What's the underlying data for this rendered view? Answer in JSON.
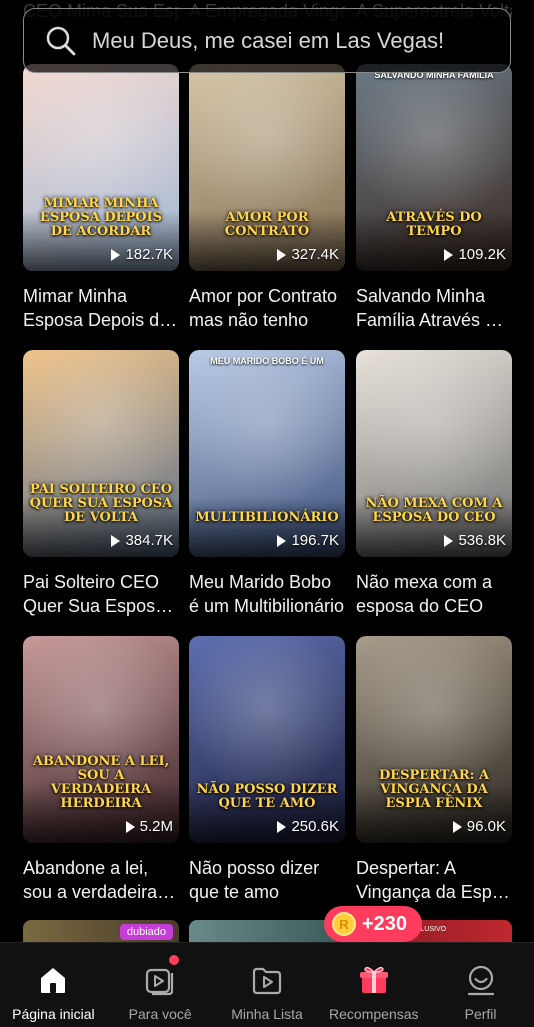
{
  "search": {
    "query": "Meu Deus, me casei em Las Vegas!"
  },
  "peek_titles": [
    "CEO Mima Sua Esposa e os Du...",
    "A Empregada Vingativa",
    "A Superestrela Volta"
  ],
  "cards": [
    {
      "title": "Mimar Minha Esposa Depois de Acordar",
      "views": "182.7K",
      "poster_top": "",
      "poster_text": "MIMAR MINHA ESPOSA DEPOIS DE ACORDAR",
      "colors": [
        "#f4d9d0",
        "#9fb8d6"
      ]
    },
    {
      "title": "Amor por Contrato mas não tenho",
      "views": "327.4K",
      "poster_top": "",
      "poster_text": "AMOR POR CONTRATO",
      "colors": [
        "#d8c6a8",
        "#7d6a50"
      ]
    },
    {
      "title": "Salvando Minha Família Através do Tempo",
      "views": "109.2K",
      "poster_top": "SALVANDO MINHA FAMÍLIA",
      "poster_text": "ATRAVÉS DO TEMPO",
      "colors": [
        "#6c7a86",
        "#3a2a22"
      ]
    },
    {
      "title": "Pai Solteiro CEO Quer Sua Esposa de Volta",
      "views": "384.7K",
      "poster_top": "",
      "poster_text": "PAI SOLTEIRO CEO QUER SUA ESPOSA DE VOLTA",
      "colors": [
        "#f0c48a",
        "#5a6f8a"
      ]
    },
    {
      "title": "Meu Marido Bobo é um Multibilionário",
      "views": "196.7K",
      "poster_top": "MEU MARIDO BOBO É UM",
      "poster_text": "MULTIBILIONÁRIO",
      "colors": [
        "#b9cbe6",
        "#3b4f7a"
      ]
    },
    {
      "title": "Não mexa com a esposa do CEO",
      "views": "536.8K",
      "poster_top": "",
      "poster_text": "NÃO MEXA COM A ESPOSA DO CEO",
      "colors": [
        "#e8e2da",
        "#6d6d6d"
      ]
    },
    {
      "title": "Abandone a lei, sou a verdadeira herdeira",
      "views": "5.2M",
      "poster_top": "",
      "poster_text": "ABANDONE A LEI, SOU A VERDADEIRA HERDEIRA",
      "colors": [
        "#c89a9a",
        "#3b2226"
      ]
    },
    {
      "title": "Não posso dizer que te amo",
      "views": "250.6K",
      "poster_top": "",
      "poster_text": "NÃO POSSO DIZER QUE TE AMO",
      "colors": [
        "#5d6fb0",
        "#1c1d3a"
      ]
    },
    {
      "title": "Despertar: A Vingança da Espia Fênix",
      "views": "96.0K",
      "poster_top": "",
      "poster_text": "DESPERTAR: A VINGANÇA DA ESPIA FÊNIX",
      "colors": [
        "#a89c8a",
        "#2a2520"
      ]
    }
  ],
  "peek_row": {
    "badge_dub": "dubiado",
    "badge_excl": "EXCLUSIVO"
  },
  "reward": {
    "value": "+230",
    "coin": "R"
  },
  "tabs": [
    {
      "label": "Página inicial",
      "icon": "home-icon",
      "active": true
    },
    {
      "label": "Para você",
      "icon": "play-cards-icon",
      "active": false
    },
    {
      "label": "Minha Lista",
      "icon": "folder-play-icon",
      "active": false
    },
    {
      "label": "Recompensas",
      "icon": "gift-icon",
      "active": false
    },
    {
      "label": "Perfil",
      "icon": "profile-icon",
      "active": false
    }
  ],
  "colors": {
    "accent": "#ff3c5e",
    "background": "#000000",
    "gift": "#ff3c5e"
  }
}
